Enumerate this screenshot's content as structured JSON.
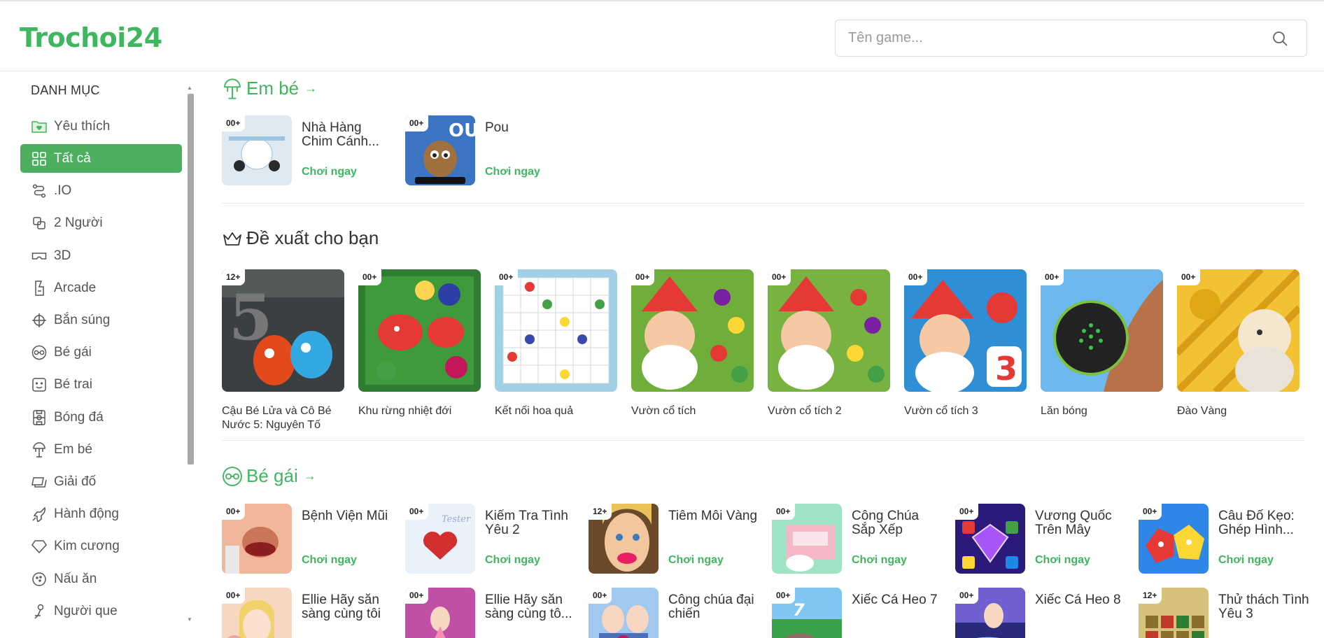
{
  "header": {
    "logo": "Trochoi24",
    "search": {
      "placeholder": "Tên game..."
    }
  },
  "sidebar": {
    "title": "DANH MỤC",
    "items": [
      {
        "label": "Yêu thích",
        "icon": "heart-folder-icon"
      },
      {
        "label": "Tất cả",
        "icon": "grid-icon",
        "active": true
      },
      {
        "label": ".IO",
        "icon": "route-icon"
      },
      {
        "label": "2 Người",
        "icon": "overlap-squares-icon"
      },
      {
        "label": "3D",
        "icon": "vr-glasses-icon"
      },
      {
        "label": "Arcade",
        "icon": "arcade-icon"
      },
      {
        "label": "Bắn súng",
        "icon": "crosshair-icon"
      },
      {
        "label": "Bé gái",
        "icon": "glasses-icon"
      },
      {
        "label": "Bé trai",
        "icon": "boy-face-icon"
      },
      {
        "label": "Bóng đá",
        "icon": "football-icon"
      },
      {
        "label": "Em bé",
        "icon": "baby-mobile-icon"
      },
      {
        "label": "Giải đố",
        "icon": "puzzle-icon"
      },
      {
        "label": "Hành động",
        "icon": "rocket-icon"
      },
      {
        "label": "Kim cương",
        "icon": "diamond-icon"
      },
      {
        "label": "Nấu ăn",
        "icon": "cooking-icon"
      },
      {
        "label": "Người que",
        "icon": "stickman-icon"
      }
    ]
  },
  "sections": {
    "baby": {
      "title": "Em bé",
      "games": [
        {
          "badge": "00+",
          "title": "Nhà Hàng Chim Cánh...",
          "play": "Chơi ngay",
          "colors": [
            "#dfe9f2",
            "#9cc3df"
          ]
        },
        {
          "badge": "00+",
          "title": "Pou",
          "play": "Chơi ngay",
          "colors": [
            "#3b74c2",
            "#1b3f7a"
          ]
        }
      ]
    },
    "recommended": {
      "title": "Đề xuất cho bạn",
      "games": [
        {
          "badge": "12+",
          "title": "Cậu Bé Lửa và Cô Bé Nước 5: Nguyên Tố",
          "colors": [
            "#3a4042",
            "#1e2224"
          ]
        },
        {
          "badge": "00+",
          "title": "Khu rừng nhiệt đới",
          "colors": [
            "#2e7d32",
            "#174d1c"
          ]
        },
        {
          "badge": "00+",
          "title": "Kết nối hoa quả",
          "colors": [
            "#bfe3ef",
            "#7fb9d6"
          ]
        },
        {
          "badge": "00+",
          "title": "Vườn cổ tích",
          "colors": [
            "#6fae3a",
            "#3b6e1e"
          ]
        },
        {
          "badge": "00+",
          "title": "Vườn cổ tích 2",
          "colors": [
            "#78b342",
            "#3e7220"
          ]
        },
        {
          "badge": "00+",
          "title": "Vườn cổ tích 3",
          "colors": [
            "#2f8fd6",
            "#1a5aa0"
          ]
        },
        {
          "badge": "00+",
          "title": "Lăn bóng",
          "colors": [
            "#6cb8ef",
            "#3d8ccf"
          ]
        },
        {
          "badge": "00+",
          "title": "Đào Vàng",
          "colors": [
            "#f2c234",
            "#c98a12"
          ]
        }
      ]
    },
    "girl": {
      "title": "Bé gái",
      "games": [
        {
          "badge": "00+",
          "title": "Bệnh Viện Mũi",
          "play": "Chơi ngay",
          "colors": [
            "#f1b79a",
            "#c9765a"
          ]
        },
        {
          "badge": "00+",
          "title": "Kiểm Tra Tình Yêu 2",
          "play": "Chơi ngay",
          "colors": [
            "#e9f1fb",
            "#b9cfe8"
          ]
        },
        {
          "badge": "12+",
          "title": "Tiêm Môi Vàng",
          "play": "Chơi ngay",
          "colors": [
            "#f3c79e",
            "#b77a4c"
          ]
        },
        {
          "badge": "00+",
          "title": "Công Chúa Sắp Xếp",
          "play": "Chơi ngay",
          "colors": [
            "#9fe3c5",
            "#f4b7c8"
          ]
        },
        {
          "badge": "00+",
          "title": "Vương Quốc Trên Mây",
          "play": "Chơi ngay",
          "colors": [
            "#6b3fc7",
            "#2b1a7a"
          ]
        },
        {
          "badge": "00+",
          "title": "Câu Đố Kẹo: Ghép Hình...",
          "play": "Chơi ngay",
          "colors": [
            "#2e86e6",
            "#1659b3"
          ]
        },
        {
          "badge": "00+",
          "title": "Ellie Hãy sẵn sàng cùng tôi",
          "play": "",
          "colors": [
            "#f6d7c2",
            "#e8a8a0"
          ]
        },
        {
          "badge": "00+",
          "title": "Ellie Hãy sẵn sàng cùng tô...",
          "play": "",
          "colors": [
            "#c04fa6",
            "#7a2a75"
          ]
        },
        {
          "badge": "00+",
          "title": "Công chúa đại chiến",
          "play": "",
          "colors": [
            "#a1c8ee",
            "#4b6fb8"
          ]
        },
        {
          "badge": "00+",
          "title": "Xiếc Cá Heo 7",
          "play": "",
          "colors": [
            "#3aa24b",
            "#1f6b2d"
          ]
        },
        {
          "badge": "00+",
          "title": "Xiếc Cá Heo 8",
          "play": "",
          "colors": [
            "#6f5fd1",
            "#2a2a7d"
          ]
        },
        {
          "badge": "12+",
          "title": "Thử thách Tình Yêu 3",
          "play": "",
          "colors": [
            "#d6c27b",
            "#8a6e2e"
          ]
        }
      ]
    }
  }
}
